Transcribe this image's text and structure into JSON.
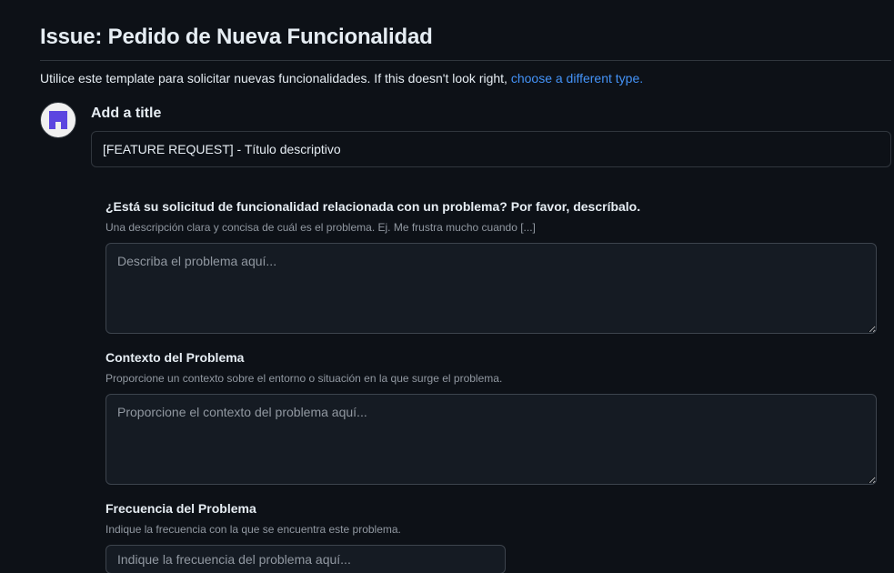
{
  "header": {
    "title": "Issue: Pedido de Nueva Funcionalidad",
    "description": "Utilice este template para solicitar nuevas funcionalidades. If this doesn't look right,",
    "change_type_link": "choose a different type."
  },
  "title_section": {
    "label": "Add a title",
    "value": "[FEATURE REQUEST] - Título descriptivo",
    "avatar_icon": "user-avatar-icon"
  },
  "fields": [
    {
      "label": "¿Está su solicitud de funcionalidad relacionada con un problema? Por favor, descríbalo.",
      "description": "Una descripción clara y concisa de cuál es el problema. Ej. Me frustra mucho cuando [...]",
      "placeholder": "Describa el problema aquí..."
    },
    {
      "label": "Contexto del Problema",
      "description": "Proporcione un contexto sobre el entorno o situación en la que surge el problema.",
      "placeholder": "Proporcione el contexto del problema aquí..."
    },
    {
      "label": "Frecuencia del Problema",
      "description": "Indique la frecuencia con la que se encuentra este problema.",
      "placeholder": "Indique la frecuencia del problema aquí..."
    }
  ],
  "colors": {
    "background": "#0d1117",
    "link": "#4493f8",
    "avatar_accent": "#5b45e0"
  }
}
